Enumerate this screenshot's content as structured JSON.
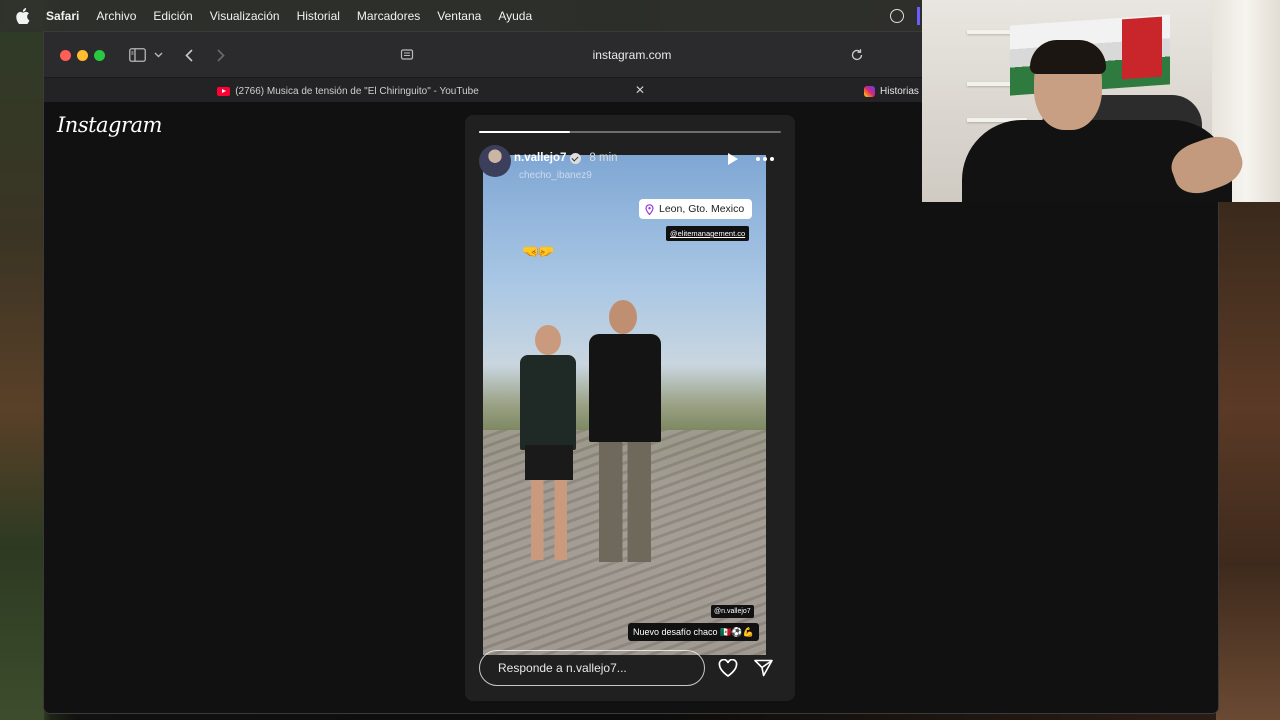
{
  "menubar": {
    "app_name": "Safari",
    "items": [
      "Archivo",
      "Edición",
      "Visualización",
      "Historial",
      "Marcadores",
      "Ventana",
      "Ayuda"
    ]
  },
  "browser": {
    "url": "instagram.com",
    "tabs": [
      {
        "title": "(2766) Musica de tensión de \"El Chiringuito\" - YouTube",
        "icon": "youtube-icon"
      },
      {
        "title": "Historias",
        "icon": "instagram-icon"
      }
    ]
  },
  "instagram": {
    "logo": "Instagram",
    "story": {
      "progress_fraction": 0.3,
      "username": "n.vallejo7",
      "time_ago": "8 min",
      "music_or_subtitle": "checho_ibanez9",
      "location": "Leon, Gto. Mexico",
      "mention_top": "@elitemanagement.co",
      "emoji_top": "🤜🤛",
      "mention_bottom": "@n.vallejo7",
      "caption": "Nuevo desafío chaco 🇲🇽⚽💪",
      "reply_placeholder": "Responde a n.vallejo7..."
    }
  },
  "colors": {
    "close": "#ff5f57",
    "minimize": "#febc2e",
    "maximize": "#28c840",
    "youtube": "#ff0033"
  }
}
